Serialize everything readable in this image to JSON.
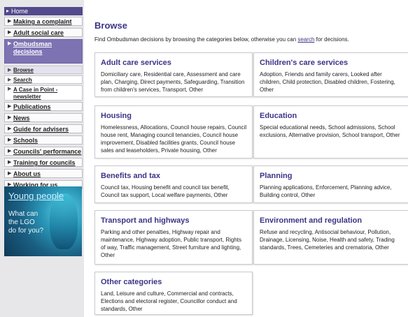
{
  "sidebar": {
    "home": "Home",
    "items": [
      {
        "label": "Making a complaint"
      },
      {
        "label": "Adult social care"
      },
      {
        "label": "Ombudsman decisions"
      }
    ],
    "subitems": [
      {
        "label": "Browse"
      },
      {
        "label": "Search"
      },
      {
        "label": "A Case in Point - newsletter"
      }
    ],
    "items_after": [
      {
        "label": "Publications"
      },
      {
        "label": "News"
      },
      {
        "label": "Guide for advisers"
      },
      {
        "label": "Schools"
      },
      {
        "label": "Councils' performance"
      },
      {
        "label": "Training for councils"
      },
      {
        "label": "About us"
      },
      {
        "label": "Working for us"
      }
    ],
    "promo": {
      "title": "Young people",
      "line1": "What can",
      "line2": "the LGO",
      "line3": "do for you?"
    }
  },
  "main": {
    "title": "Browse",
    "intro_before": "Find Ombudsman decisions by browsing the categories below, otherwise you can ",
    "intro_link": "search",
    "intro_after": " for decisions.",
    "categories": [
      {
        "title": "Adult care services",
        "text": "Domiciliary care, Residential care, Assessment and care plan, Charging, Direct payments, Safeguarding, Transition from children's services, Transport, Other"
      },
      {
        "title": "Children's care services",
        "text": "Adoption, Friends and family carers, Looked after children, Child protection, Disabled children, Fostering, Other"
      },
      {
        "title": "Housing",
        "text": "Homelessness, Allocations, Council house repairs, Council house rent, Managing council tenancies, Council house improvement, Disabled facilities grants, Council house sales and leaseholders, Private housing, Other"
      },
      {
        "title": "Education",
        "text": "Special educational needs, School admissions, School exclusions, Alternative provision, School transport, Other"
      },
      {
        "title": "Benefits and tax",
        "text": "Council tax, Housing benefit and council tax benefit, Council tax support, Local welfare payments, Other"
      },
      {
        "title": "Planning",
        "text": "Planning applications, Enforcement, Planning advice, Building control, Other"
      },
      {
        "title": "Transport and highways",
        "text": "Parking and other penalties, Highway repair and maintenance, Highway adoption, Public transport, Rights of way, Traffic management, Street furniture and lighting, Other"
      },
      {
        "title": "Environment and regulation",
        "text": "Refuse and recycling, Antisocial behaviour, Pollution, Drainage, Licensing, Noise, Health and safety, Trading standards, Trees, Cemeteries and crematoria, Other"
      },
      {
        "title": "Other categories",
        "text": "Land, Leisure and culture, Commercial and contracts, Elections and electoral register, Councillor conduct and standards, Other"
      }
    ]
  }
}
